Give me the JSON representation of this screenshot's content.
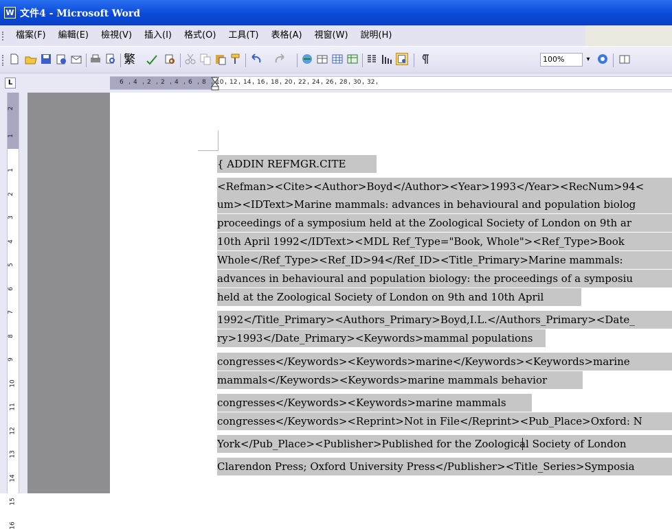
{
  "window": {
    "title": "文件4 - Microsoft Word",
    "app_icon_glyph": "W"
  },
  "menu": [
    {
      "label": "檔案(F)"
    },
    {
      "label": "編輯(E)"
    },
    {
      "label": "檢視(V)"
    },
    {
      "label": "插入(I)"
    },
    {
      "label": "格式(O)"
    },
    {
      "label": "工具(T)"
    },
    {
      "label": "表格(A)"
    },
    {
      "label": "視窗(W)"
    },
    {
      "label": "說明(H)"
    }
  ],
  "toolbar": {
    "traditional_chinese_label": "繁",
    "zoom_value": "100%",
    "zoom_arrow": "▾"
  },
  "ruler": {
    "tab_selector": "L",
    "horizontal_numbers": [
      "6",
      "4",
      "2",
      "2",
      "4",
      "6",
      "8",
      "10",
      "12",
      "14",
      "16",
      "18",
      "20",
      "22",
      "24",
      "26",
      "28",
      "30",
      "32"
    ],
    "vertical_numbers": [
      "2",
      "1",
      "1",
      "2",
      "3",
      "4",
      "5",
      "6",
      "7",
      "8",
      "9",
      "10",
      "11",
      "12",
      "13",
      "14",
      "15",
      "16"
    ]
  },
  "document": {
    "lines": [
      "{ ADDIN REFMGR.CITE",
      "<Refman><Cite><Author>Boyd</Author><Year>1993</Year><RecNum>94<",
      "um><IDText>Marine mammals: advances in behavioural and population biolog",
      "proceedings of a symposium held at the Zoological Society of London on 9th ar",
      "10th April 1992</IDText><MDL Ref_Type=\"Book, Whole\"><Ref_Type>Book",
      "Whole</Ref_Type><Ref_ID>94</Ref_ID><Title_Primary>Marine mammals:",
      "advances in behavioural and population biology: the proceedings of a symposiu",
      "held at the Zoological Society of London on 9th and 10th April",
      "1992</Title_Primary><Authors_Primary>Boyd,I.L.</Authors_Primary><Date_",
      "ry>1993</Date_Primary><Keywords>mammal populations",
      "congresses</Keywords><Keywords>marine</Keywords><Keywords>marine",
      "mammals</Keywords><Keywords>marine mammals behavior",
      "congresses</Keywords><Keywords>marine mammals",
      "congresses</Keywords><Reprint>Not in File</Reprint><Pub_Place>Oxford: N",
      "York</Pub_Place><Publisher>Published for the Zoological Society of London",
      "Clarendon Press; Oxford University Press</Publisher><Title_Series>Symposia"
    ]
  },
  "colors": {
    "title_bar": "#0a4ad8",
    "menu_bar": "#e3e3f1",
    "selection": "#c6c6c6",
    "gray_margin": "#8e8e92"
  }
}
